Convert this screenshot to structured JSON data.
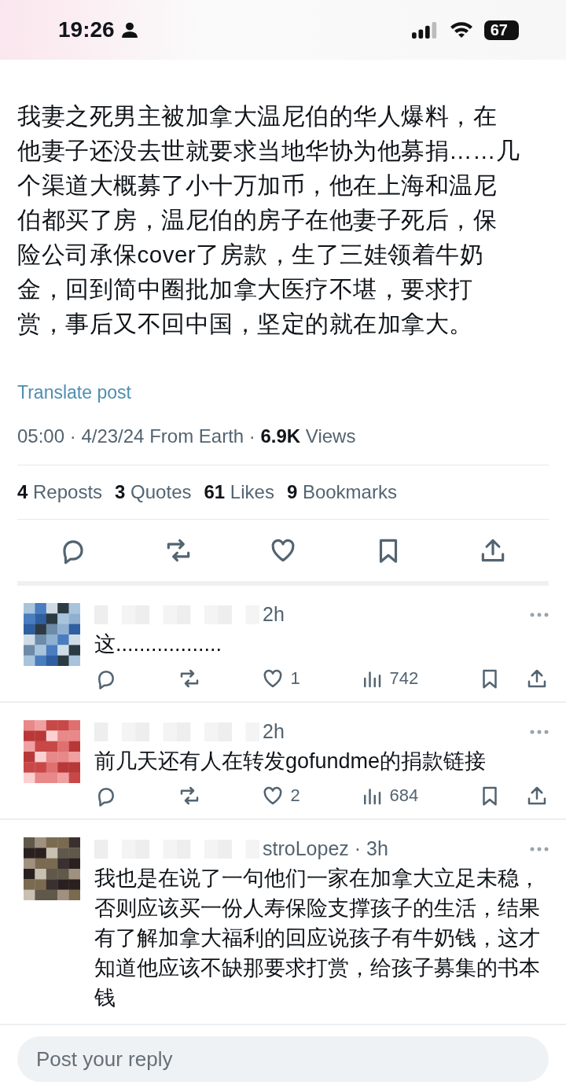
{
  "status_bar": {
    "time": "19:26",
    "battery": "67"
  },
  "post": {
    "text": "我妻之死男主被加拿大温尼伯的华人爆料，在他妻子还没去世就要求当地华协为他募捐……几个渠道大概募了小十万加币，他在上海和温尼伯都买了房，温尼伯的房子在他妻子死后，保险公司承保cover了房款，生了三娃领着牛奶金，回到简中圈批加拿大医疗不堪，要求打赏，事后又不回中国，坚定的就在加拿大。",
    "translate": "Translate post",
    "meta": "05:00 · 4/23/24 From Earth · ",
    "views_count": "6.9K",
    "views_label": " Views",
    "stats": [
      {
        "count": "4",
        "label": "Reposts"
      },
      {
        "count": "3",
        "label": "Quotes"
      },
      {
        "count": "61",
        "label": "Likes"
      },
      {
        "count": "9",
        "label": "Bookmarks"
      }
    ]
  },
  "replies": [
    {
      "handle": "2h",
      "text": "这..................",
      "likes": "1",
      "views": "742"
    },
    {
      "handle": "2h",
      "text": "前几天还有人在转发gofundme的捐款链接",
      "likes": "2",
      "views": "684"
    },
    {
      "handle": "stroLopez · 3h",
      "text": "我也是在说了一句他们一家在加拿大立足未稳，否则应该买一份人寿保险支撑孩子的生活，结果有了解加拿大福利的回应说孩子有牛奶钱，这才知道他应该不缺那要求打赏，给孩子募集的书本钱"
    }
  ],
  "reply_field": {
    "placeholder": "Post your reply"
  }
}
